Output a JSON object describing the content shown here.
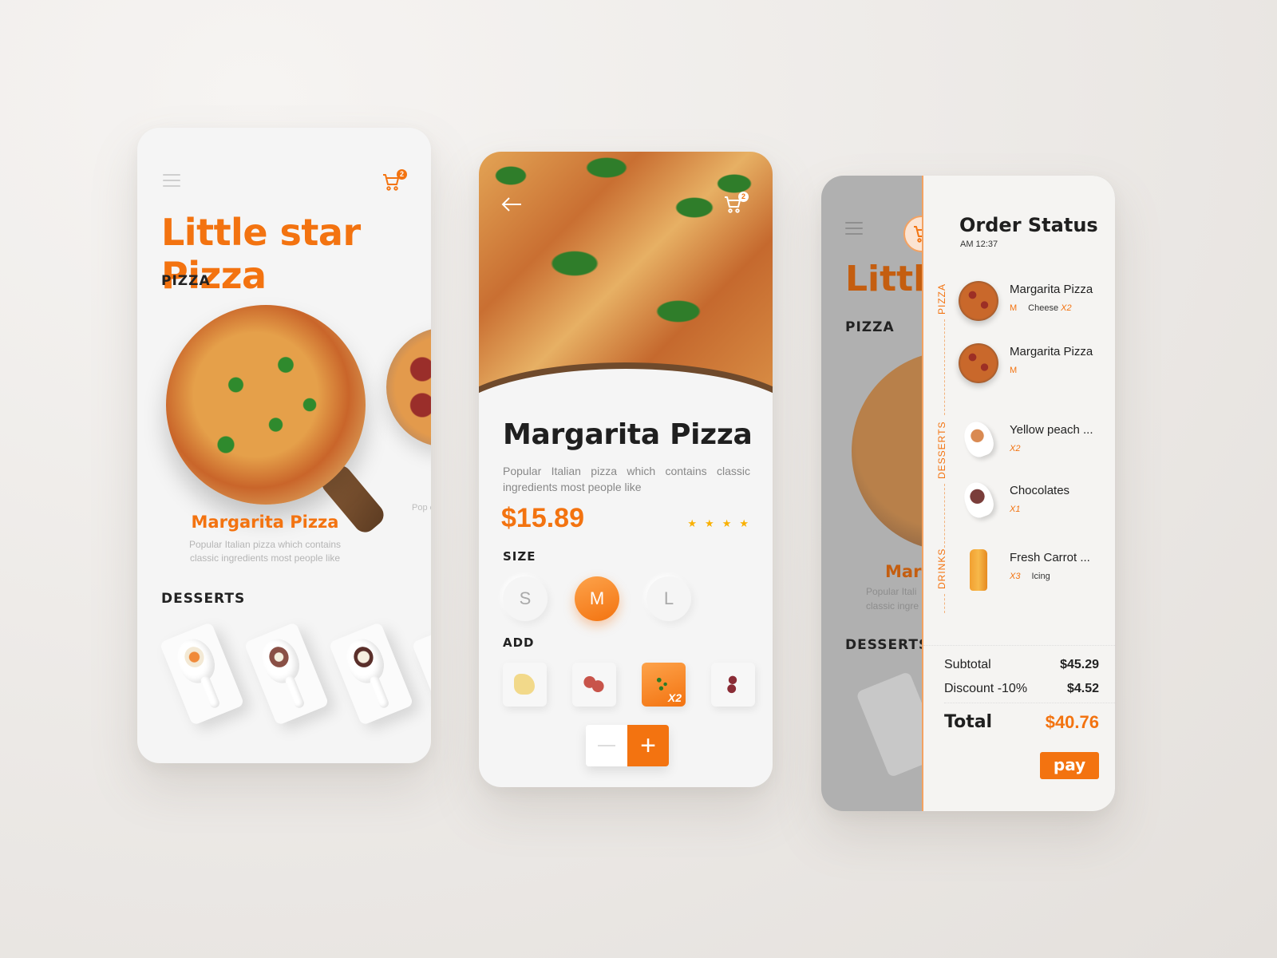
{
  "colors": {
    "accent": "#f37310",
    "star": "#f9b000",
    "text_dark": "#1f1f1f"
  },
  "menu_screen": {
    "menu_icon": "hamburger-menu-icon",
    "cart_icon": "shopping-cart-icon",
    "cart_count": "2",
    "brand_title": "Little star Pizza",
    "pizza_section": "PIZZA",
    "featured_item": {
      "name": "Margarita Pizza",
      "description": "Popular Italian pizza which contains classic ingredients most people like"
    },
    "next_item_desc_partial": "Pop cont",
    "desserts_section": "DESSERTS"
  },
  "detail_screen": {
    "back_icon": "arrow-left-icon",
    "cart_count": "2",
    "title": "Margarita Pizza",
    "description": "Popular Italian pizza which contains classic ingredients most people like",
    "price": "$15.89",
    "rating": 4,
    "rating_max": 4,
    "size_label": "SIZE",
    "sizes": [
      {
        "label": "S",
        "selected": false
      },
      {
        "label": "M",
        "selected": true
      },
      {
        "label": "L",
        "selected": false
      }
    ],
    "add_label": "ADD",
    "addons": [
      {
        "name": "cheese",
        "selected": false,
        "qty": ""
      },
      {
        "name": "ham",
        "selected": false,
        "qty": ""
      },
      {
        "name": "basil",
        "selected": true,
        "qty": "X2"
      },
      {
        "name": "salami",
        "selected": false,
        "qty": ""
      }
    ],
    "stepper": {
      "minus": "—",
      "plus": "+"
    }
  },
  "order_screen": {
    "bg_title_partial": "Little",
    "bg_pizza_section": "PIZZA",
    "bg_item_name_partial": "Marg",
    "bg_item_desc_partial": "Popular Itali classic ingre",
    "bg_desserts_section": "DESSERTS",
    "title": "Order Status",
    "time": "AM 12:37",
    "categories": [
      "PIZZA",
      "DESSERTS",
      "DRINKS"
    ],
    "items": [
      {
        "name": "Margarita Pizza",
        "size": "M",
        "extra": "Cheese",
        "extra_qty": "X2",
        "category": "PIZZA"
      },
      {
        "name": "Margarita Pizza",
        "size": "M",
        "extra": "",
        "extra_qty": "",
        "category": "PIZZA"
      },
      {
        "name": "Yellow peach ...",
        "qty": "X2",
        "category": "DESSERTS"
      },
      {
        "name": "Chocolates",
        "qty": "X1",
        "category": "DESSERTS"
      },
      {
        "name": "Fresh Carrot ...",
        "qty": "X3",
        "extra": "Icing",
        "category": "DRINKS"
      }
    ],
    "subtotal_label": "Subtotal",
    "subtotal": "$45.29",
    "discount_label": "Discount -10%",
    "discount": "$4.52",
    "total_label": "Total",
    "total": "$40.76",
    "pay_label": "pay"
  }
}
